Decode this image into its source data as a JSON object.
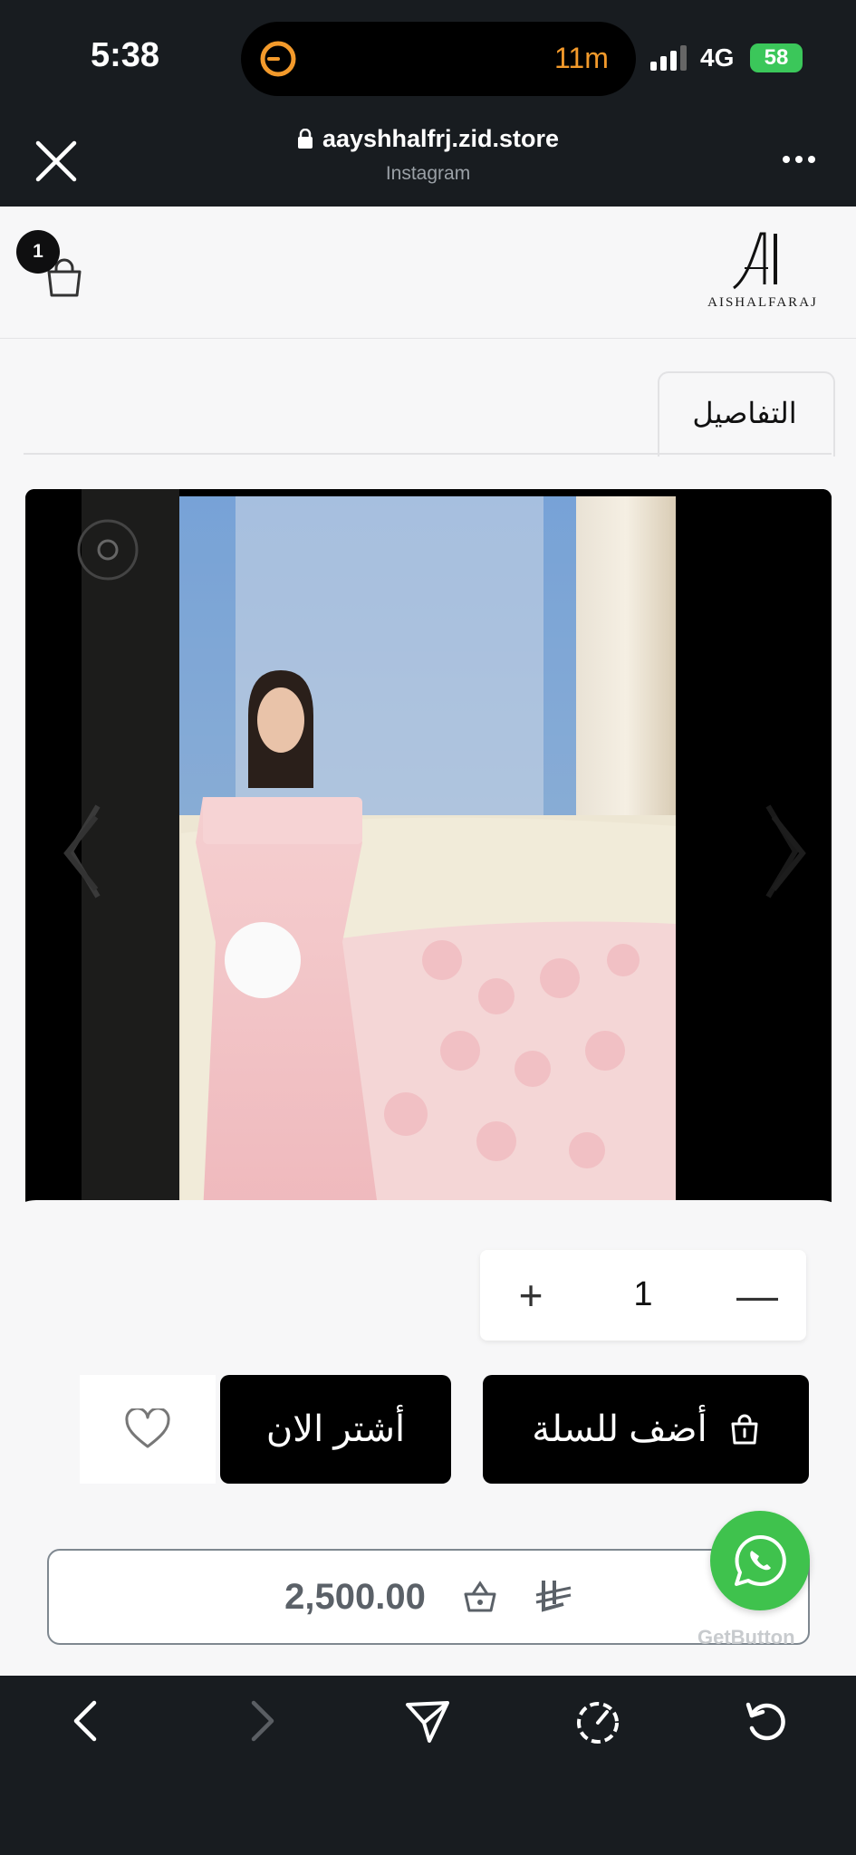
{
  "status_bar": {
    "time": "5:38",
    "activity_label": "11m",
    "network": "4G",
    "battery": "58"
  },
  "browser": {
    "url": "aayshhalfrj.zid.store",
    "source": "Instagram"
  },
  "store": {
    "cart_count": "1",
    "logo_text": "AISHALFARAJ"
  },
  "tabs": {
    "details_label": "التفاصيل"
  },
  "product": {
    "quantity": "1",
    "add_to_cart_label": "أضف للسلة",
    "buy_now_label": "أشتر الان",
    "price": "2,500.00"
  },
  "widget": {
    "brand": "GetButton"
  },
  "colors": {
    "accent": "#000000",
    "whatsapp": "#3fc24d",
    "dark_bar": "#181c20",
    "timer": "#f39a2b"
  }
}
